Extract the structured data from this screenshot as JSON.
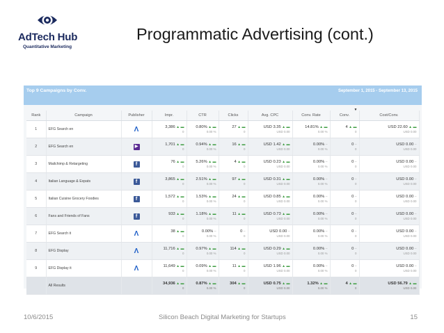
{
  "logo": {
    "name": "AdTech Hub",
    "tagline": "Quantitative Marketing"
  },
  "slide": {
    "title": "Programmatic Advertising (cont.)"
  },
  "panel": {
    "title": "Top 9 Campaigns by Conv.",
    "date_range": "September 1, 2015 - September 13, 2015"
  },
  "table": {
    "headers": [
      "Rank",
      "Campaign",
      "Publisher",
      "Impr.",
      "CTR",
      "Clicks",
      "Avg. CPC",
      "Conv. Rate",
      "Conv.",
      "Cost/Conv."
    ],
    "rows": [
      {
        "rank": "1",
        "campaign": "EFG Search en",
        "publisher": "adwords-icon",
        "impr": "3,386",
        "impr_s": "0",
        "ctr": "0.80%",
        "ctr_s": "0.00 %",
        "clicks": "27",
        "clicks_s": "0",
        "cpc": "USD 3.35",
        "cpc_s": "USD 0.00",
        "crate": "14.81%",
        "crate_s": "0.00 %",
        "conv": "4",
        "conv_s": "0",
        "cost": "USD 22.60",
        "cost_s": "USD 0.00"
      },
      {
        "rank": "2",
        "campaign": "EFG Search en",
        "publisher": "yahoo-icon",
        "impr": "1,701",
        "impr_s": "0",
        "ctr": "0.94%",
        "ctr_s": "0.00 %",
        "clicks": "16",
        "clicks_s": "0",
        "cpc": "USD 1.42",
        "cpc_s": "USD 0.00",
        "crate": "0.00%",
        "crate_s": "0.00 %",
        "conv": "0",
        "conv_s": "0",
        "cost": "USD 0.00",
        "cost_s": "USD 0.00"
      },
      {
        "rank": "3",
        "campaign": "Mailchimp & Retargeting",
        "publisher": "facebook-icon",
        "impr": "76",
        "impr_s": "0",
        "ctr": "5.26%",
        "ctr_s": "0.00 %",
        "clicks": "4",
        "clicks_s": "0",
        "cpc": "USD 0.23",
        "cpc_s": "USD 0.00",
        "crate": "0.00%",
        "crate_s": "0.00 %",
        "conv": "0",
        "conv_s": "0",
        "cost": "USD 0.00",
        "cost_s": "USD 0.00"
      },
      {
        "rank": "4",
        "campaign": "Italian Language & Expats",
        "publisher": "facebook-icon",
        "impr": "3,865",
        "impr_s": "0",
        "ctr": "2.51%",
        "ctr_s": "0.00 %",
        "clicks": "97",
        "clicks_s": "0",
        "cpc": "USD 0.31",
        "cpc_s": "USD 0.00",
        "crate": "0.00%",
        "crate_s": "0.00 %",
        "conv": "0",
        "conv_s": "0",
        "cost": "USD 0.00",
        "cost_s": "USD 0.00"
      },
      {
        "rank": "5",
        "campaign": "Italian Cuisine Grocery Foodies",
        "publisher": "facebook-icon",
        "impr": "1,572",
        "impr_s": "0",
        "ctr": "1.53%",
        "ctr_s": "0.00 %",
        "clicks": "24",
        "clicks_s": "0",
        "cpc": "USD 0.85",
        "cpc_s": "USD 0.00",
        "crate": "0.00%",
        "crate_s": "0.00 %",
        "conv": "0",
        "conv_s": "0",
        "cost": "USD 0.00",
        "cost_s": "USD 0.00"
      },
      {
        "rank": "6",
        "campaign": "Fans and Friends of Fans",
        "publisher": "facebook-icon",
        "impr": "933",
        "impr_s": "0",
        "ctr": "1.18%",
        "ctr_s": "0.00 %",
        "clicks": "11",
        "clicks_s": "0",
        "cpc": "USD 0.73",
        "cpc_s": "USD 0.00",
        "crate": "0.00%",
        "crate_s": "0.00 %",
        "conv": "0",
        "conv_s": "0",
        "cost": "USD 0.00",
        "cost_s": "USD 0.00"
      },
      {
        "rank": "7",
        "campaign": "EFG Search it",
        "publisher": "adwords-icon",
        "impr": "38",
        "impr_s": "0",
        "ctr": "0.00%",
        "ctr_s": "0.00 %",
        "clicks": "0",
        "clicks_s": "0",
        "cpc": "USD 0.00",
        "cpc_s": "USD 0.00",
        "crate": "0.00%",
        "crate_s": "0.00 %",
        "conv": "0",
        "conv_s": "0",
        "cost": "USD 0.00",
        "cost_s": "USD 0.00"
      },
      {
        "rank": "8",
        "campaign": "EFG Display",
        "publisher": "adwords-icon",
        "impr": "11,716",
        "impr_s": "0",
        "ctr": "0.97%",
        "ctr_s": "0.00 %",
        "clicks": "114",
        "clicks_s": "0",
        "cpc": "USD 0.29",
        "cpc_s": "USD 0.00",
        "crate": "0.00%",
        "crate_s": "0.00 %",
        "conv": "0",
        "conv_s": "0",
        "cost": "USD 0.00",
        "cost_s": "USD 0.00"
      },
      {
        "rank": "9",
        "campaign": "EFG Display it",
        "publisher": "adwords-icon",
        "impr": "11,649",
        "impr_s": "0",
        "ctr": "0.09%",
        "ctr_s": "0.00 %",
        "clicks": "11",
        "clicks_s": "0",
        "cpc": "USD 1.96",
        "cpc_s": "USD 0.00",
        "crate": "0.00%",
        "crate_s": "0.00 %",
        "conv": "0",
        "conv_s": "0",
        "cost": "USD 0.00",
        "cost_s": "USD 0.00"
      }
    ],
    "total": {
      "label": "All Results",
      "impr": "34,936",
      "impr_s": "0",
      "ctr": "0.87%",
      "ctr_s": "0.00 %",
      "clicks": "304",
      "clicks_s": "0",
      "cpc": "USD 0.75",
      "cpc_s": "USD 0.00",
      "crate": "1.32%",
      "crate_s": "0.00 %",
      "conv": "4",
      "conv_s": "0",
      "cost": "USD 56.79",
      "cost_s": "USD 0.00"
    }
  },
  "footer": {
    "date": "10/6/2015",
    "center": "Silicon Beach Digital Marketing for Startups",
    "page": "15"
  },
  "colors": {
    "header_bar": "#a6cdee",
    "title": "#1a1a1a",
    "logo": "#1b2a5e",
    "up_arrow": "#3d9c40"
  }
}
